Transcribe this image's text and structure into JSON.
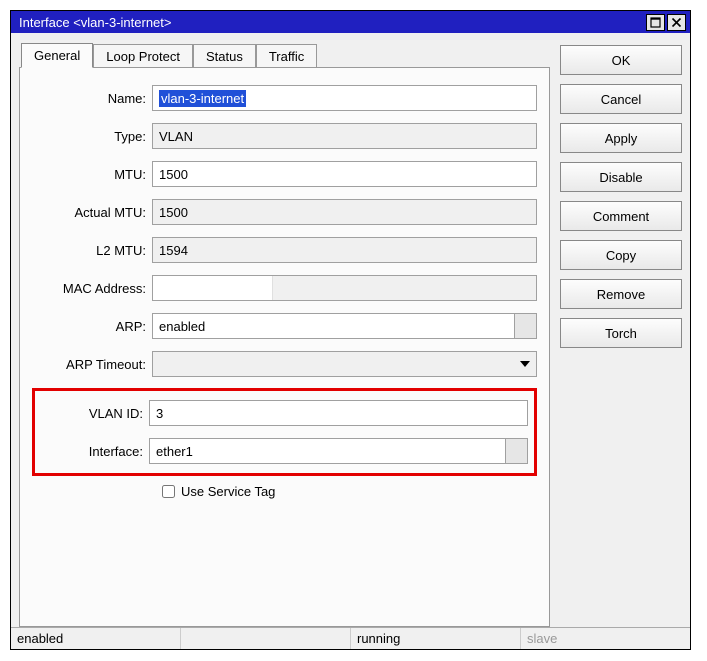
{
  "window": {
    "title": "Interface <vlan-3-internet>"
  },
  "tabs": {
    "general": "General",
    "loop_protect": "Loop Protect",
    "status": "Status",
    "traffic": "Traffic"
  },
  "form": {
    "name_label": "Name:",
    "name_value": "vlan-3-internet",
    "type_label": "Type:",
    "type_value": "VLAN",
    "mtu_label": "MTU:",
    "mtu_value": "1500",
    "actual_mtu_label": "Actual MTU:",
    "actual_mtu_value": "1500",
    "l2_mtu_label": "L2 MTU:",
    "l2_mtu_value": "1594",
    "mac_label": "MAC Address:",
    "mac_value": "",
    "arp_label": "ARP:",
    "arp_value": "enabled",
    "arp_timeout_label": "ARP Timeout:",
    "arp_timeout_value": "",
    "vlan_id_label": "VLAN ID:",
    "vlan_id_value": "3",
    "interface_label": "Interface:",
    "interface_value": "ether1",
    "use_service_tag_label": "Use Service Tag"
  },
  "buttons": {
    "ok": "OK",
    "cancel": "Cancel",
    "apply": "Apply",
    "disable": "Disable",
    "comment": "Comment",
    "copy": "Copy",
    "remove": "Remove",
    "torch": "Torch"
  },
  "status": {
    "enabled": "enabled",
    "running": "running",
    "slave": "slave"
  }
}
